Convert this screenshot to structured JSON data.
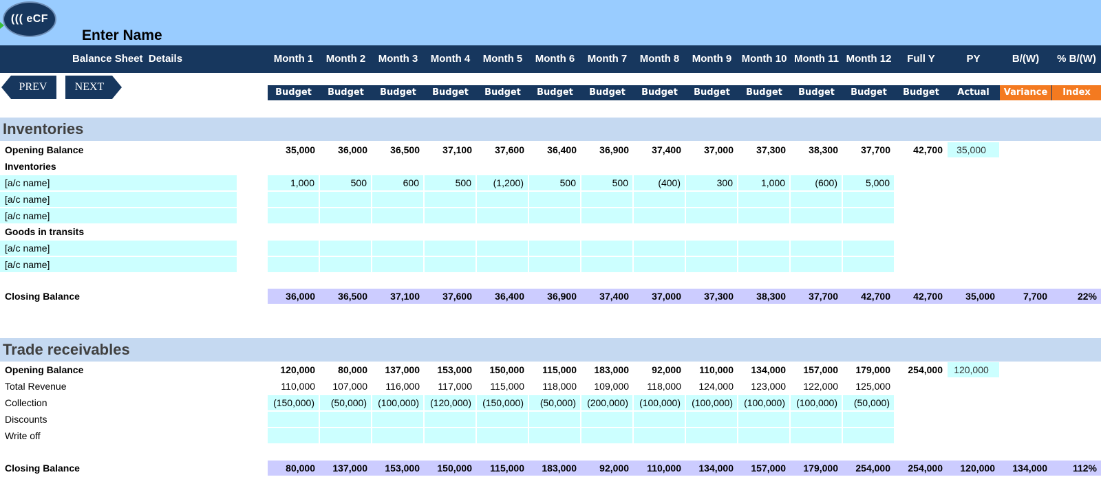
{
  "header": {
    "logo_text": "((( eCF",
    "enter_name": "Enter Name",
    "title": "Balance Sheet  Details",
    "columns": [
      "Month 1",
      "Month 2",
      "Month 3",
      "Month 4",
      "Month 5",
      "Month 6",
      "Month 7",
      "Month 8",
      "Month 9",
      "Month 10",
      "Month 11",
      "Month 12",
      "Full Y",
      "PY",
      "B/(W)",
      "% B/(W)"
    ],
    "subcolumns": [
      "Budget",
      "Budget",
      "Budget",
      "Budget",
      "Budget",
      "Budget",
      "Budget",
      "Budget",
      "Budget",
      "Budget",
      "Budget",
      "Budget",
      "Budget",
      "Actual",
      "Variance",
      "Index"
    ]
  },
  "nav": {
    "prev": "PREV",
    "next": "NEXT"
  },
  "colors": {
    "header_bg": "#17375E",
    "top_bg": "#99CCFF",
    "section_bg": "#C5D9F1",
    "input_bg": "#CCFFFF",
    "total_bg": "#CCCCFF",
    "accent_orange": "#F47A20"
  },
  "inventories": {
    "title": "Inventories",
    "opening_label": "Opening Balance",
    "opening": [
      "35,000",
      "36,000",
      "36,500",
      "37,100",
      "37,600",
      "36,400",
      "36,900",
      "37,400",
      "37,000",
      "37,300",
      "38,300",
      "37,700",
      "42,700",
      "35,000"
    ],
    "group1_label": "Inventories",
    "group1_rows": [
      {
        "label": "[a/c name]",
        "values": [
          "1,000",
          "500",
          "600",
          "500",
          "(1,200)",
          "500",
          "500",
          "(400)",
          "300",
          "1,000",
          "(600)",
          "5,000"
        ]
      },
      {
        "label": "[a/c name]",
        "values": [
          "",
          "",
          "",
          "",
          "",
          "",
          "",
          "",
          "",
          "",
          "",
          ""
        ]
      },
      {
        "label": "[a/c name]",
        "values": [
          "",
          "",
          "",
          "",
          "",
          "",
          "",
          "",
          "",
          "",
          "",
          ""
        ]
      }
    ],
    "group2_label": "Goods in transits",
    "group2_rows": [
      {
        "label": "[a/c name]",
        "values": [
          "",
          "",
          "",
          "",
          "",
          "",
          "",
          "",
          "",
          "",
          "",
          ""
        ]
      },
      {
        "label": "[a/c name]",
        "values": [
          "",
          "",
          "",
          "",
          "",
          "",
          "",
          "",
          "",
          "",
          "",
          ""
        ]
      }
    ],
    "closing_label": "Closing Balance",
    "closing": [
      "36,000",
      "36,500",
      "37,100",
      "37,600",
      "36,400",
      "36,900",
      "37,400",
      "37,000",
      "37,300",
      "38,300",
      "37,700",
      "42,700",
      "42,700",
      "35,000",
      "7,700",
      "22%"
    ]
  },
  "receivables": {
    "title": "Trade receivables",
    "opening_label": "Opening Balance",
    "opening": [
      "120,000",
      "80,000",
      "137,000",
      "153,000",
      "150,000",
      "115,000",
      "183,000",
      "92,000",
      "110,000",
      "134,000",
      "157,000",
      "179,000",
      "254,000",
      "120,000"
    ],
    "rows": [
      {
        "label": "Total Revenue",
        "values": [
          "110,000",
          "107,000",
          "116,000",
          "117,000",
          "115,000",
          "118,000",
          "109,000",
          "118,000",
          "124,000",
          "123,000",
          "122,000",
          "125,000"
        ],
        "input": false
      },
      {
        "label": "Collection",
        "values": [
          "(150,000)",
          "(50,000)",
          "(100,000)",
          "(120,000)",
          "(150,000)",
          "(50,000)",
          "(200,000)",
          "(100,000)",
          "(100,000)",
          "(100,000)",
          "(100,000)",
          "(50,000)"
        ],
        "input": true
      },
      {
        "label": "Discounts",
        "values": [
          "",
          "",
          "",
          "",
          "",
          "",
          "",
          "",
          "",
          "",
          "",
          ""
        ],
        "input": true
      },
      {
        "label": "Write off",
        "values": [
          "",
          "",
          "",
          "",
          "",
          "",
          "",
          "",
          "",
          "",
          "",
          ""
        ],
        "input": true
      }
    ],
    "closing_label": "Closing Balance",
    "closing": [
      "80,000",
      "137,000",
      "153,000",
      "150,000",
      "115,000",
      "183,000",
      "92,000",
      "110,000",
      "134,000",
      "157,000",
      "179,000",
      "254,000",
      "254,000",
      "120,000",
      "134,000",
      "112%"
    ]
  }
}
